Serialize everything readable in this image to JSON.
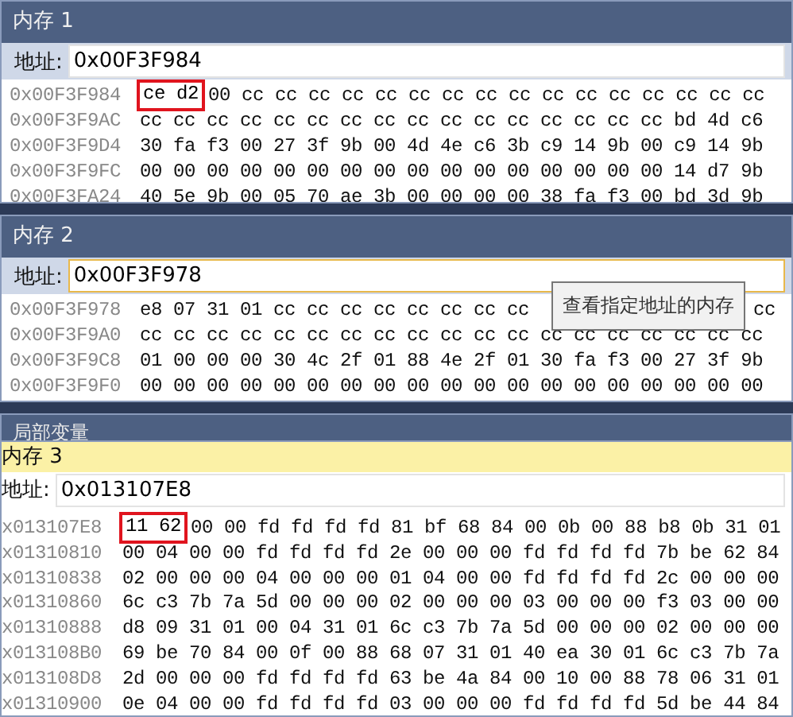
{
  "panes": [
    {
      "title": "内存 1",
      "active": false,
      "address_label": "地址:",
      "address": "0x00F3F984",
      "focused": false,
      "rows": [
        {
          "address": "0x00F3F984",
          "boxed": "ce d2",
          "bytes": "00 cc cc cc cc cc cc cc cc cc cc cc cc cc cc cc cc"
        },
        {
          "address": "0x00F3F9AC",
          "bytes": "cc cc cc cc cc cc cc cc cc cc cc cc cc cc cc cc bd 4d c6"
        },
        {
          "address": "0x00F3F9D4",
          "bytes": "30 fa f3 00 27 3f 9b 00 4d 4e c6 3b c9 14 9b 00 c9 14 9b"
        },
        {
          "address": "0x00F3F9FC",
          "bytes": "00 00 00 00 00 00 00 00 00 00 00 00 00 00 00 00 14 d7 9b"
        },
        {
          "address": "0x00F3FA24",
          "bytes": "40 5e 9b 00 05 70 ae 3b 00 00 00 00 38 fa f3 00 bd 3d 9b"
        }
      ]
    },
    {
      "title": "内存 2",
      "active": false,
      "address_label": "地址:",
      "address": "0x00F3F978",
      "focused": true,
      "tooltip": "查看指定地址的内存",
      "rows": [
        {
          "address": "0x00F3F978",
          "bytes": "e8 07 31 01 cc cc cc cc cc cc cc cc",
          "tail": "cc"
        },
        {
          "address": "0x00F3F9A0",
          "bytes": "cc cc cc cc cc cc cc cc cc cc cc cc cc cc cc cc cc cc cc"
        },
        {
          "address": "0x00F3F9C8",
          "bytes": "01 00 00 00 30 4c 2f 01 88 4e 2f 01 30 fa f3 00 27 3f 9b"
        },
        {
          "address": "0x00F3F9F0",
          "bytes": "00 00 00 00 00 00 00 00 00 00 00 00 00 00 00 00 00 00 00"
        }
      ]
    },
    {
      "title": "局部变量",
      "kind": "header"
    },
    {
      "title": "内存 3",
      "active": true,
      "address_label": "地址:",
      "address": "0x013107E8",
      "focused": false,
      "rows": [
        {
          "address": "x013107E8",
          "boxed": "11 62",
          "bytes": "00 00 fd fd fd fd 81 bf 68 84 00 0b 00 88 b8 0b 31 01"
        },
        {
          "address": "x01310810",
          "bytes": "00 04 00 00 fd fd fd fd 2e 00 00 00 fd fd fd fd 7b be 62 84"
        },
        {
          "address": "x01310838",
          "bytes": "02 00 00 00 04 00 00 00 01 04 00 00 fd fd fd fd 2c 00 00 00"
        },
        {
          "address": "x01310860",
          "bytes": "6c c3 7b 7a 5d 00 00 00 02 00 00 00 03 00 00 00 f3 03 00 00"
        },
        {
          "address": "x01310888",
          "bytes": "d8 09 31 01 00 04 31 01 6c c3 7b 7a 5d 00 00 00 02 00 00 00"
        },
        {
          "address": "x013108B0",
          "bytes": "69 be 70 84 00 0f 00 88 68 07 31 01 40 ea 30 01 6c c3 7b 7a"
        },
        {
          "address": "x013108D8",
          "bytes": "2d 00 00 00 fd fd fd fd 63 be 4a 84 00 10 00 88 78 06 31 01"
        },
        {
          "address": "x01310900",
          "bytes": "0e 04 00 00 fd fd fd fd 03 00 00 00 fd fd fd fd 5d be 44 84"
        }
      ]
    }
  ]
}
